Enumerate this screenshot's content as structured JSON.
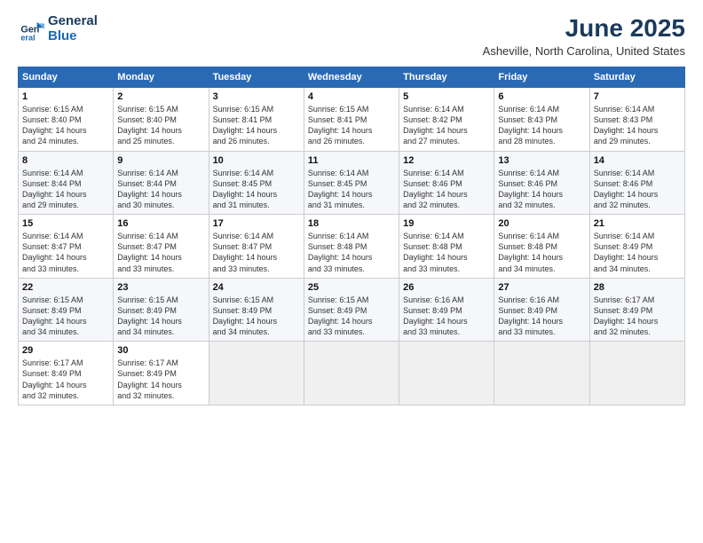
{
  "logo": {
    "general": "General",
    "blue": "Blue"
  },
  "header": {
    "month_year": "June 2025",
    "location": "Asheville, North Carolina, United States"
  },
  "weekdays": [
    "Sunday",
    "Monday",
    "Tuesday",
    "Wednesday",
    "Thursday",
    "Friday",
    "Saturday"
  ],
  "weeks": [
    [
      {
        "day": "1",
        "rise": "6:15 AM",
        "set": "8:40 PM",
        "hours": "14 hours and 24 minutes"
      },
      {
        "day": "2",
        "rise": "6:15 AM",
        "set": "8:40 PM",
        "hours": "14 hours and 25 minutes"
      },
      {
        "day": "3",
        "rise": "6:15 AM",
        "set": "8:41 PM",
        "hours": "14 hours and 26 minutes"
      },
      {
        "day": "4",
        "rise": "6:15 AM",
        "set": "8:41 PM",
        "hours": "14 hours and 26 minutes"
      },
      {
        "day": "5",
        "rise": "6:14 AM",
        "set": "8:42 PM",
        "hours": "14 hours and 27 minutes"
      },
      {
        "day": "6",
        "rise": "6:14 AM",
        "set": "8:43 PM",
        "hours": "14 hours and 28 minutes"
      },
      {
        "day": "7",
        "rise": "6:14 AM",
        "set": "8:43 PM",
        "hours": "14 hours and 29 minutes"
      }
    ],
    [
      {
        "day": "8",
        "rise": "6:14 AM",
        "set": "8:44 PM",
        "hours": "14 hours and 29 minutes"
      },
      {
        "day": "9",
        "rise": "6:14 AM",
        "set": "8:44 PM",
        "hours": "14 hours and 30 minutes"
      },
      {
        "day": "10",
        "rise": "6:14 AM",
        "set": "8:45 PM",
        "hours": "14 hours and 31 minutes"
      },
      {
        "day": "11",
        "rise": "6:14 AM",
        "set": "8:45 PM",
        "hours": "14 hours and 31 minutes"
      },
      {
        "day": "12",
        "rise": "6:14 AM",
        "set": "8:46 PM",
        "hours": "14 hours and 32 minutes"
      },
      {
        "day": "13",
        "rise": "6:14 AM",
        "set": "8:46 PM",
        "hours": "14 hours and 32 minutes"
      },
      {
        "day": "14",
        "rise": "6:14 AM",
        "set": "8:46 PM",
        "hours": "14 hours and 32 minutes"
      }
    ],
    [
      {
        "day": "15",
        "rise": "6:14 AM",
        "set": "8:47 PM",
        "hours": "14 hours and 33 minutes"
      },
      {
        "day": "16",
        "rise": "6:14 AM",
        "set": "8:47 PM",
        "hours": "14 hours and 33 minutes"
      },
      {
        "day": "17",
        "rise": "6:14 AM",
        "set": "8:47 PM",
        "hours": "14 hours and 33 minutes"
      },
      {
        "day": "18",
        "rise": "6:14 AM",
        "set": "8:48 PM",
        "hours": "14 hours and 33 minutes"
      },
      {
        "day": "19",
        "rise": "6:14 AM",
        "set": "8:48 PM",
        "hours": "14 hours and 33 minutes"
      },
      {
        "day": "20",
        "rise": "6:14 AM",
        "set": "8:48 PM",
        "hours": "14 hours and 34 minutes"
      },
      {
        "day": "21",
        "rise": "6:14 AM",
        "set": "8:49 PM",
        "hours": "14 hours and 34 minutes"
      }
    ],
    [
      {
        "day": "22",
        "rise": "6:15 AM",
        "set": "8:49 PM",
        "hours": "14 hours and 34 minutes"
      },
      {
        "day": "23",
        "rise": "6:15 AM",
        "set": "8:49 PM",
        "hours": "14 hours and 34 minutes"
      },
      {
        "day": "24",
        "rise": "6:15 AM",
        "set": "8:49 PM",
        "hours": "14 hours and 34 minutes"
      },
      {
        "day": "25",
        "rise": "6:15 AM",
        "set": "8:49 PM",
        "hours": "14 hours and 33 minutes"
      },
      {
        "day": "26",
        "rise": "6:16 AM",
        "set": "8:49 PM",
        "hours": "14 hours and 33 minutes"
      },
      {
        "day": "27",
        "rise": "6:16 AM",
        "set": "8:49 PM",
        "hours": "14 hours and 33 minutes"
      },
      {
        "day": "28",
        "rise": "6:17 AM",
        "set": "8:49 PM",
        "hours": "14 hours and 32 minutes"
      }
    ],
    [
      {
        "day": "29",
        "rise": "6:17 AM",
        "set": "8:49 PM",
        "hours": "14 hours and 32 minutes"
      },
      {
        "day": "30",
        "rise": "6:17 AM",
        "set": "8:49 PM",
        "hours": "14 hours and 32 minutes"
      },
      null,
      null,
      null,
      null,
      null
    ]
  ]
}
